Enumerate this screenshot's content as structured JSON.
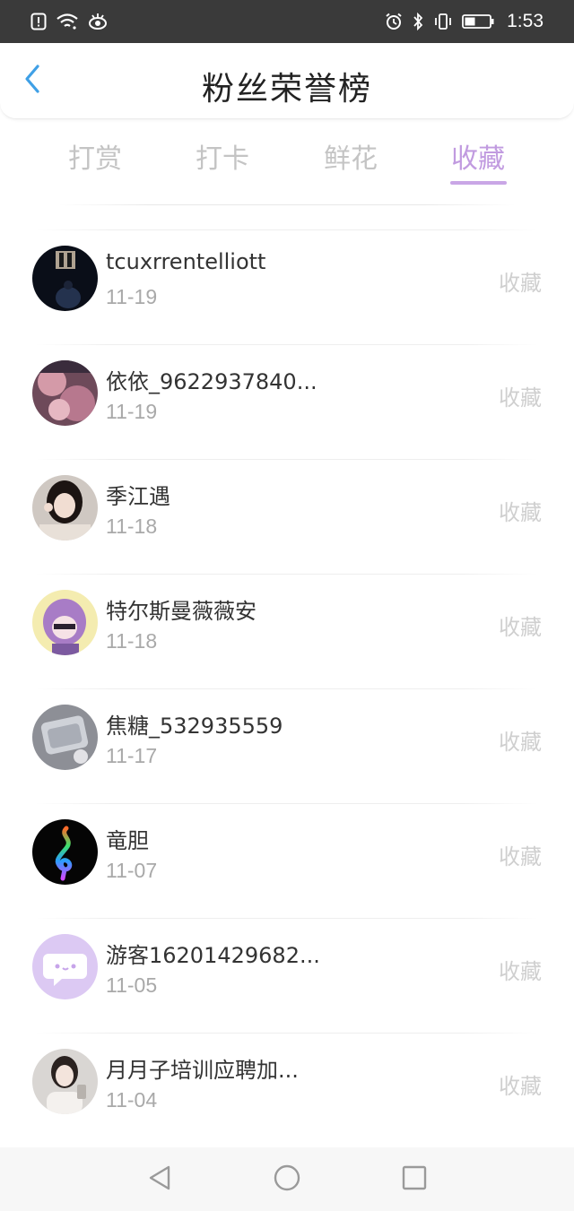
{
  "status_bar": {
    "time": "1:53",
    "left_icons": [
      "alert-icon",
      "wifi-icon",
      "eye-icon"
    ],
    "right_icons": [
      "alarm-icon",
      "bluetooth-icon",
      "vibrate-icon",
      "battery-icon"
    ]
  },
  "header": {
    "title": "粉丝荣誉榜"
  },
  "tabs": [
    {
      "label": "打赏",
      "active": false
    },
    {
      "label": "打卡",
      "active": false
    },
    {
      "label": "鲜花",
      "active": false
    },
    {
      "label": "收藏",
      "active": true
    }
  ],
  "colors": {
    "accent": "#c19be0",
    "tab_inactive": "#c4c4c4",
    "status_bar": "#3a3a3a"
  },
  "list": [
    {
      "name": "tcuxrrentelliott",
      "date": "11-19",
      "action": "收藏"
    },
    {
      "name": "依依_9622937840...",
      "date": "11-19",
      "action": "收藏"
    },
    {
      "name": "季江遇",
      "date": "11-18",
      "action": "收藏"
    },
    {
      "name": "特尔斯曼薇薇安",
      "date": "11-18",
      "action": "收藏"
    },
    {
      "name": "焦糖_532935559",
      "date": "11-17",
      "action": "收藏"
    },
    {
      "name": "竜胆",
      "date": "11-07",
      "action": "收藏"
    },
    {
      "name": "游客16201429682...",
      "date": "11-05",
      "action": "收藏"
    },
    {
      "name": "月月子培训应聘加...",
      "date": "11-04",
      "action": "收藏"
    }
  ],
  "nav_bar": {
    "buttons": [
      "back-triangle-icon",
      "home-circle-icon",
      "recents-square-icon"
    ]
  }
}
